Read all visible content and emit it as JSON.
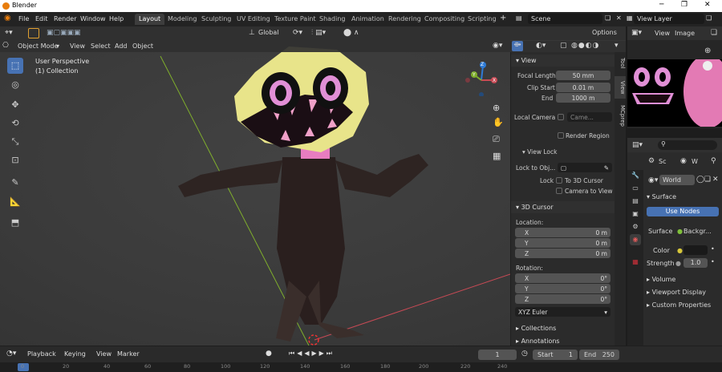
{
  "window": {
    "title": "Blender",
    "minimize": "─",
    "maximize": "❐",
    "close": "✕"
  },
  "menu": [
    "File",
    "Edit",
    "Render",
    "Window",
    "Help"
  ],
  "workspaces": [
    "Layout",
    "Modeling",
    "Sculpting",
    "UV Editing",
    "Texture Paint",
    "Shading",
    "Animation",
    "Rendering",
    "Compositing",
    "Scripting"
  ],
  "active_workspace": "Layout",
  "add_workspace": "+",
  "scene": "Scene",
  "view_layer": "View Layer",
  "viewport_header": {
    "transform": "Global",
    "options": "Options"
  },
  "mode_header": {
    "mode": "Object Mode",
    "view": "View",
    "select": "Select",
    "add": "Add",
    "object": "Object"
  },
  "viewport_overlay": {
    "perspective": "User Perspective",
    "collection": "(1) Collection"
  },
  "gizmo": {
    "x": "X",
    "y": "Y",
    "z": "Z"
  },
  "npanel": {
    "view_header": "View",
    "focal_length_label": "Focal Length",
    "focal_length": "50 mm",
    "clip_start_label": "Clip Start",
    "clip_start": "0.01 m",
    "end_label": "End",
    "end": "1000 m",
    "local_camera_label": "Local Camera",
    "local_camera": "Came...",
    "render_region": "Render Region",
    "view_lock_header": "View Lock",
    "lock_to_obj_label": "Lock to Obj...",
    "lock_label": "Lock",
    "to_3d_cursor": "To 3D Cursor",
    "camera_to_view": "Camera to View",
    "cursor_header": "3D Cursor",
    "location_label": "Location:",
    "loc": [
      {
        "axis": "X",
        "value": "0 m"
      },
      {
        "axis": "Y",
        "value": "0 m"
      },
      {
        "axis": "Z",
        "value": "0 m"
      }
    ],
    "rotation_label": "Rotation:",
    "rot": [
      {
        "axis": "X",
        "value": "0°"
      },
      {
        "axis": "Y",
        "value": "0°"
      },
      {
        "axis": "Z",
        "value": "0°"
      }
    ],
    "rotation_mode": "XYZ Euler",
    "collections_header": "Collections",
    "annotations_header": "Annotations"
  },
  "side_tabs": [
    "Tool",
    "View",
    "MCprep"
  ],
  "image_editor": {
    "view": "View",
    "image": "Image"
  },
  "properties": {
    "tab_sc": "Sc",
    "tab_w": "W",
    "world_name": "World",
    "surface_header": "Surface",
    "use_nodes": "Use Nodes",
    "surface_label": "Surface",
    "surface_value": "Backgr...",
    "color_label": "Color",
    "strength_label": "Strength",
    "strength_value": "1.0",
    "volume": "Volume",
    "viewport_display": "Viewport Display",
    "custom_properties": "Custom Properties"
  },
  "timeline": {
    "playback": "Playback",
    "keying": "Keying",
    "view": "View",
    "marker": "Marker",
    "current_frame": "1",
    "start_label": "Start",
    "start": "1",
    "end_label": "End",
    "end": "250"
  },
  "ruler_ticks": [
    "0",
    "20",
    "40",
    "60",
    "80",
    "100",
    "120",
    "140",
    "160",
    "180",
    "200",
    "220",
    "240"
  ],
  "colors": {
    "accent": "#4772b3",
    "header": "#303030",
    "panel": "#2b2b2b"
  }
}
